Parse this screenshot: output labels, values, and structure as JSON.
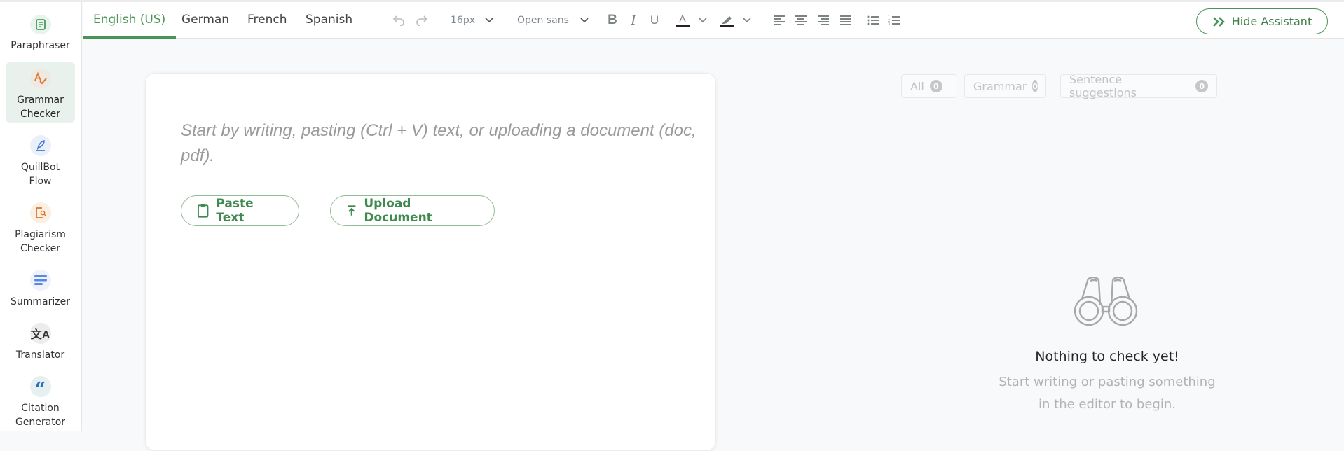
{
  "sidebar": {
    "items": [
      {
        "label": "Paraphraser",
        "icon": "paraphraser-icon",
        "color": "#4a9a5c",
        "bg": "#e8f3ec",
        "active": false
      },
      {
        "label": "Grammar Checker",
        "icon": "grammar-checker-icon",
        "color": "#e07a2f",
        "bg": "#efe9e4",
        "active": true
      },
      {
        "label": "QuillBot Flow",
        "icon": "quillbot-flow-icon",
        "color": "#4b78d6",
        "bg": "#eaf0fa",
        "active": false
      },
      {
        "label": "Plagiarism Checker",
        "icon": "plagiarism-checker-icon",
        "color": "#d9752d",
        "bg": "#fbeee2",
        "active": false
      },
      {
        "label": "Summarizer",
        "icon": "summarizer-icon",
        "color": "#5a86e6",
        "bg": "#eef2fa",
        "active": false
      },
      {
        "label": "Translator",
        "icon": "translator-icon",
        "color": "#333333",
        "bg": "#ececec",
        "active": false
      },
      {
        "label": "Citation Generator",
        "icon": "citation-generator-icon",
        "color": "#2f6fb5",
        "bg": "#e6f0f0",
        "active": false
      }
    ]
  },
  "toolbar": {
    "tabs": [
      {
        "label": "English (US)",
        "active": true
      },
      {
        "label": "German",
        "active": false
      },
      {
        "label": "French",
        "active": false
      },
      {
        "label": "Spanish",
        "active": false
      }
    ],
    "font_size": "16px",
    "font_family": "Open sans",
    "hide_assistant_label": "Hide Assistant"
  },
  "editor": {
    "placeholder": "Start by writing, pasting (Ctrl + V) text, or uploading a document (doc, pdf).",
    "paste_label": "Paste Text",
    "upload_label": "Upload Document"
  },
  "assistant": {
    "filters": [
      {
        "label": "All",
        "count": "0"
      },
      {
        "label": "Grammar",
        "count": "0"
      },
      {
        "label": "Sentence suggestions",
        "count": "0"
      }
    ],
    "empty_title": "Nothing to check yet!",
    "empty_line1": "Start writing or pasting something",
    "empty_line2": "in the editor to begin."
  },
  "colors": {
    "accent": "#499557",
    "muted_icon": "#7d837e"
  }
}
